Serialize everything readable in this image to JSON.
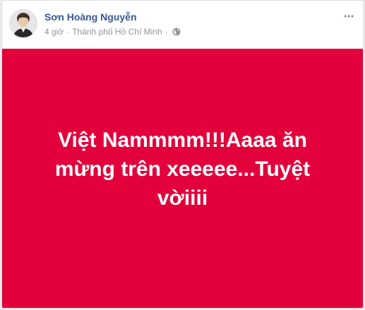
{
  "post": {
    "author_name": "Sơn Hoàng Nguyễn",
    "timestamp": "4 giờ",
    "separator": "·",
    "location": "Thành phố Hồ Chí Minh",
    "privacy_icon": "globe-icon",
    "menu_icon": "more-options-icon",
    "status_text": "Việt Nammmm!!!Aaaa ăn mừng trên xeeeee...Tuyệt vờiiii",
    "background_color": "#e2013b",
    "text_color": "#ffffff",
    "name_color": "#365899",
    "meta_color": "#90949c"
  }
}
